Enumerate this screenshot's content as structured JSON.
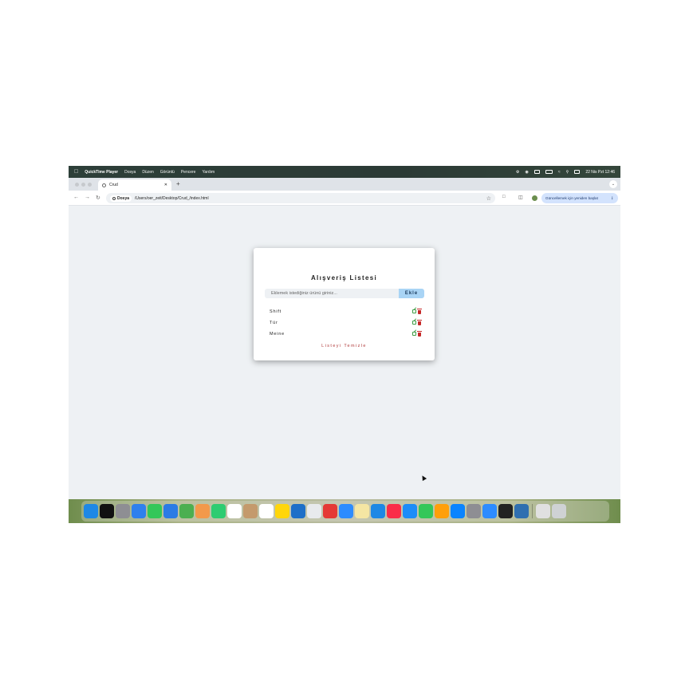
{
  "menubar": {
    "app_name": "QuickTime Player",
    "menus": [
      "Dosya",
      "Düzen",
      "Görüntü",
      "Pencere",
      "Yardım"
    ],
    "clock": "22 Nis Pzt  12:46"
  },
  "browser": {
    "tab_title": "Crud",
    "site_chip": "Dosya",
    "url": "/Users/oer_zeit/Desktop/Crud_/index.html",
    "update_label": "Güncellemek için yeniden başlat"
  },
  "app": {
    "title": "Alışveriş Listesi",
    "input_placeholder": "Eklemek istediğiniz ürünü giriniz...",
    "add_label": "Ekle",
    "items": [
      {
        "name": "Shift"
      },
      {
        "name": "Tür"
      },
      {
        "name": "Meine"
      }
    ],
    "clear_label": "Listeyi Temizle"
  },
  "icons": {
    "edit": "edit-icon",
    "delete": "trash-icon",
    "edit_color": "#3f9e47",
    "delete_color": "#c62828",
    "accent": "#a9d4f5"
  },
  "dock": {
    "icons": [
      "finder",
      "apple-tv",
      "launchpad",
      "safari",
      "messages",
      "mail",
      "maps",
      "photos",
      "facetime",
      "calendar",
      "contacts",
      "reminders",
      "notes",
      "vscode",
      "chrome",
      "opera",
      "zoom",
      "notes2",
      "vscode-insiders",
      "music",
      "keynote",
      "numbers",
      "pages",
      "app-store",
      "system-settings",
      "zoom-app",
      "terminal",
      "preview",
      "files",
      "trash"
    ],
    "colors": [
      "#1e88e5",
      "#111111",
      "#8e8e93",
      "#2f80ed",
      "#34c759",
      "#2c7be5",
      "#4caf50",
      "#f2994a",
      "#2ecc71",
      "#ffffff",
      "#c49a6c",
      "#ffffff",
      "#ffd60a",
      "#1e6fc8",
      "#e8eaed",
      "#e53935",
      "#2d8cff",
      "#f5e6a3",
      "#1e88e5",
      "#fa2d48",
      "#1d8cf8",
      "#34c759",
      "#ff9f0a",
      "#0a84ff",
      "#8e8e93",
      "#2d8cff",
      "#222222",
      "#2f6fb0",
      "#e0e0e0",
      "#cfd2d4"
    ]
  }
}
